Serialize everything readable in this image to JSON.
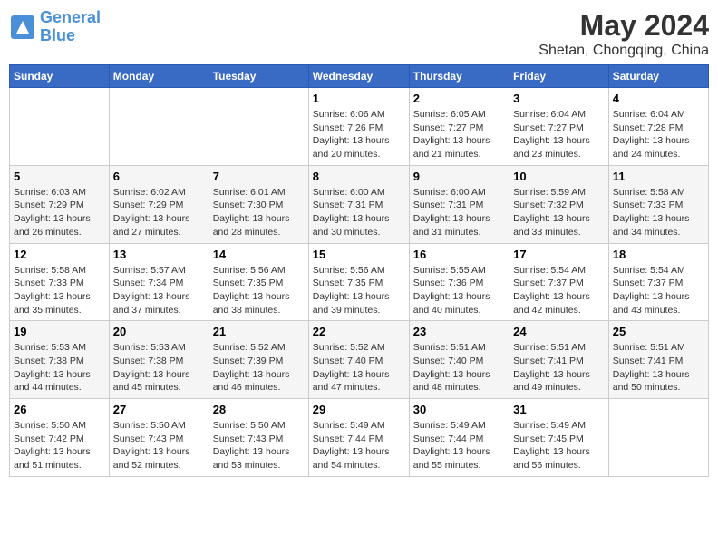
{
  "header": {
    "logo_line1": "General",
    "logo_line2": "Blue",
    "month": "May 2024",
    "location": "Shetan, Chongqing, China"
  },
  "days_of_week": [
    "Sunday",
    "Monday",
    "Tuesday",
    "Wednesday",
    "Thursday",
    "Friday",
    "Saturday"
  ],
  "weeks": [
    [
      {
        "day": "",
        "info": ""
      },
      {
        "day": "",
        "info": ""
      },
      {
        "day": "",
        "info": ""
      },
      {
        "day": "1",
        "info": "Sunrise: 6:06 AM\nSunset: 7:26 PM\nDaylight: 13 hours\nand 20 minutes."
      },
      {
        "day": "2",
        "info": "Sunrise: 6:05 AM\nSunset: 7:27 PM\nDaylight: 13 hours\nand 21 minutes."
      },
      {
        "day": "3",
        "info": "Sunrise: 6:04 AM\nSunset: 7:27 PM\nDaylight: 13 hours\nand 23 minutes."
      },
      {
        "day": "4",
        "info": "Sunrise: 6:04 AM\nSunset: 7:28 PM\nDaylight: 13 hours\nand 24 minutes."
      }
    ],
    [
      {
        "day": "5",
        "info": "Sunrise: 6:03 AM\nSunset: 7:29 PM\nDaylight: 13 hours\nand 26 minutes."
      },
      {
        "day": "6",
        "info": "Sunrise: 6:02 AM\nSunset: 7:29 PM\nDaylight: 13 hours\nand 27 minutes."
      },
      {
        "day": "7",
        "info": "Sunrise: 6:01 AM\nSunset: 7:30 PM\nDaylight: 13 hours\nand 28 minutes."
      },
      {
        "day": "8",
        "info": "Sunrise: 6:00 AM\nSunset: 7:31 PM\nDaylight: 13 hours\nand 30 minutes."
      },
      {
        "day": "9",
        "info": "Sunrise: 6:00 AM\nSunset: 7:31 PM\nDaylight: 13 hours\nand 31 minutes."
      },
      {
        "day": "10",
        "info": "Sunrise: 5:59 AM\nSunset: 7:32 PM\nDaylight: 13 hours\nand 33 minutes."
      },
      {
        "day": "11",
        "info": "Sunrise: 5:58 AM\nSunset: 7:33 PM\nDaylight: 13 hours\nand 34 minutes."
      }
    ],
    [
      {
        "day": "12",
        "info": "Sunrise: 5:58 AM\nSunset: 7:33 PM\nDaylight: 13 hours\nand 35 minutes."
      },
      {
        "day": "13",
        "info": "Sunrise: 5:57 AM\nSunset: 7:34 PM\nDaylight: 13 hours\nand 37 minutes."
      },
      {
        "day": "14",
        "info": "Sunrise: 5:56 AM\nSunset: 7:35 PM\nDaylight: 13 hours\nand 38 minutes."
      },
      {
        "day": "15",
        "info": "Sunrise: 5:56 AM\nSunset: 7:35 PM\nDaylight: 13 hours\nand 39 minutes."
      },
      {
        "day": "16",
        "info": "Sunrise: 5:55 AM\nSunset: 7:36 PM\nDaylight: 13 hours\nand 40 minutes."
      },
      {
        "day": "17",
        "info": "Sunrise: 5:54 AM\nSunset: 7:37 PM\nDaylight: 13 hours\nand 42 minutes."
      },
      {
        "day": "18",
        "info": "Sunrise: 5:54 AM\nSunset: 7:37 PM\nDaylight: 13 hours\nand 43 minutes."
      }
    ],
    [
      {
        "day": "19",
        "info": "Sunrise: 5:53 AM\nSunset: 7:38 PM\nDaylight: 13 hours\nand 44 minutes."
      },
      {
        "day": "20",
        "info": "Sunrise: 5:53 AM\nSunset: 7:38 PM\nDaylight: 13 hours\nand 45 minutes."
      },
      {
        "day": "21",
        "info": "Sunrise: 5:52 AM\nSunset: 7:39 PM\nDaylight: 13 hours\nand 46 minutes."
      },
      {
        "day": "22",
        "info": "Sunrise: 5:52 AM\nSunset: 7:40 PM\nDaylight: 13 hours\nand 47 minutes."
      },
      {
        "day": "23",
        "info": "Sunrise: 5:51 AM\nSunset: 7:40 PM\nDaylight: 13 hours\nand 48 minutes."
      },
      {
        "day": "24",
        "info": "Sunrise: 5:51 AM\nSunset: 7:41 PM\nDaylight: 13 hours\nand 49 minutes."
      },
      {
        "day": "25",
        "info": "Sunrise: 5:51 AM\nSunset: 7:41 PM\nDaylight: 13 hours\nand 50 minutes."
      }
    ],
    [
      {
        "day": "26",
        "info": "Sunrise: 5:50 AM\nSunset: 7:42 PM\nDaylight: 13 hours\nand 51 minutes."
      },
      {
        "day": "27",
        "info": "Sunrise: 5:50 AM\nSunset: 7:43 PM\nDaylight: 13 hours\nand 52 minutes."
      },
      {
        "day": "28",
        "info": "Sunrise: 5:50 AM\nSunset: 7:43 PM\nDaylight: 13 hours\nand 53 minutes."
      },
      {
        "day": "29",
        "info": "Sunrise: 5:49 AM\nSunset: 7:44 PM\nDaylight: 13 hours\nand 54 minutes."
      },
      {
        "day": "30",
        "info": "Sunrise: 5:49 AM\nSunset: 7:44 PM\nDaylight: 13 hours\nand 55 minutes."
      },
      {
        "day": "31",
        "info": "Sunrise: 5:49 AM\nSunset: 7:45 PM\nDaylight: 13 hours\nand 56 minutes."
      },
      {
        "day": "",
        "info": ""
      }
    ]
  ]
}
